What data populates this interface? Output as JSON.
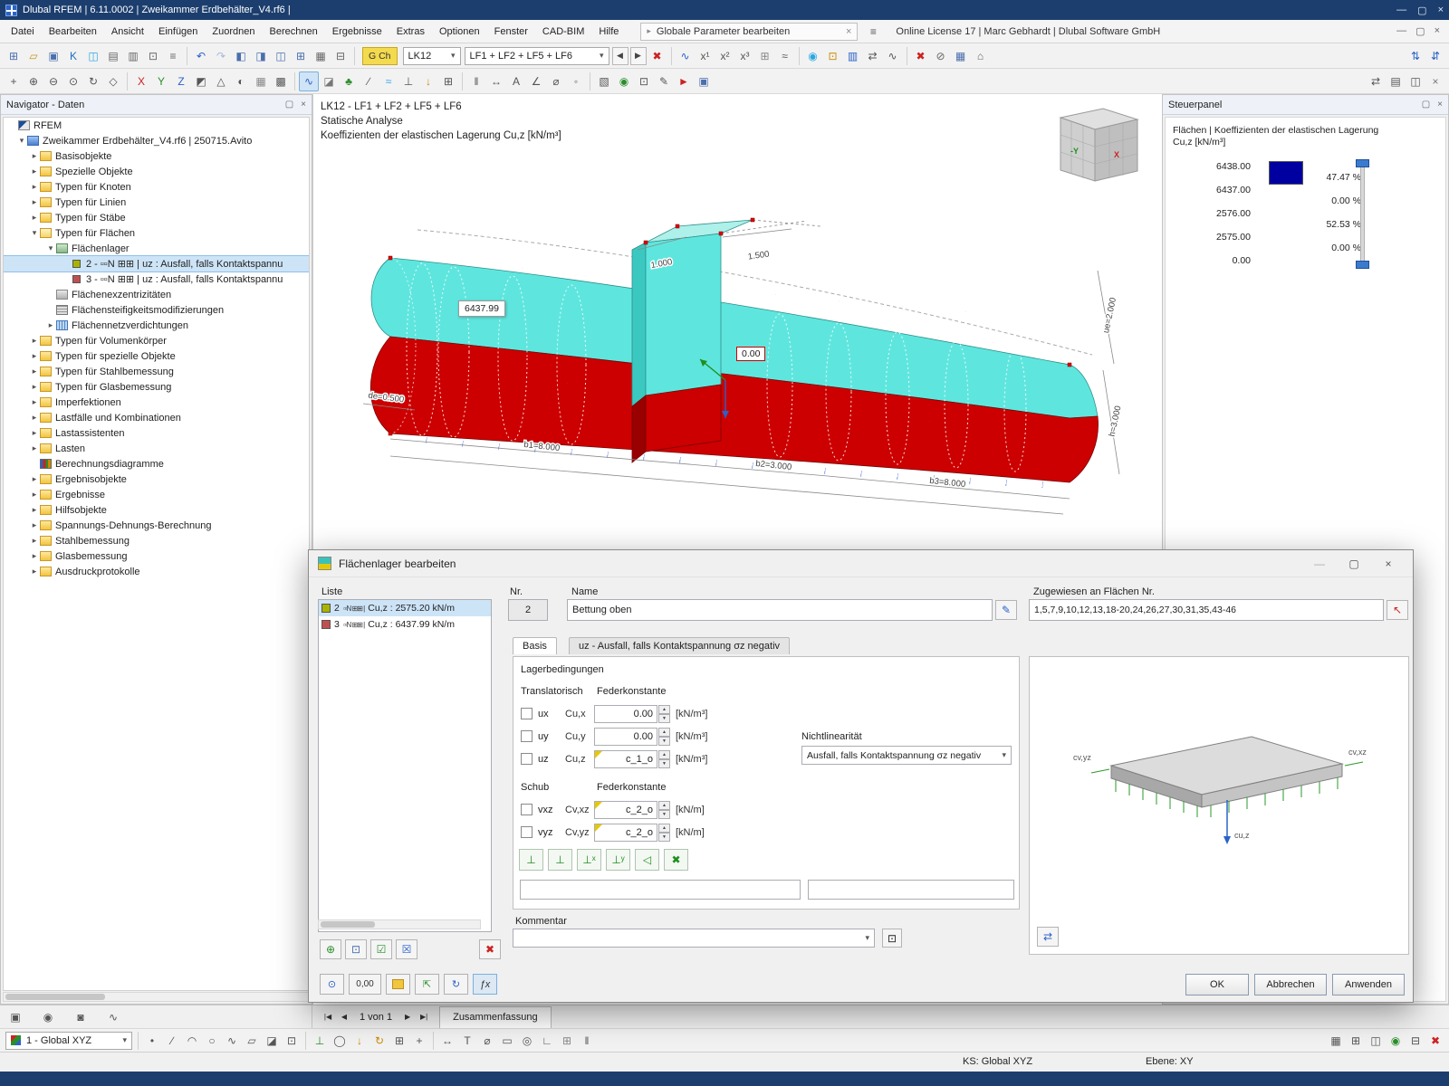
{
  "titlebar": {
    "title": "Dlubal RFEM | 6.11.0002 | Zweikammer Erdbehälter_V4.rf6 |"
  },
  "menubar": {
    "items": [
      "Datei",
      "Bearbeiten",
      "Ansicht",
      "Einfügen",
      "Zuordnen",
      "Berechnen",
      "Ergebnisse",
      "Extras",
      "Optionen",
      "Fenster",
      "CAD-BIM",
      "Hilfe"
    ],
    "search_label": "Globale Parameter bearbeiten",
    "license_text": "Online License 17 | Marc Gebhardt | Dlubal Software GmbH"
  },
  "toolbars": {
    "chip_label": "G Ch",
    "combo_lk": "LK12",
    "combo_lf": "LF1 + LF2 + LF5 + LF6",
    "row1a": [
      {
        "n": "new-model-icon",
        "g": "⊞",
        "c": "#4a6fae"
      },
      {
        "n": "open-model-icon",
        "g": "▱",
        "c": "#c89616"
      },
      {
        "n": "save-icon",
        "g": "▣",
        "c": "#4a6fae"
      },
      {
        "n": "knowledge-base-icon",
        "g": "K",
        "c": "#1a6fc4"
      },
      {
        "n": "teamwork-icon",
        "g": "◫",
        "c": "#29a8e0"
      },
      {
        "n": "print-icon",
        "g": "▤",
        "c": "#666666"
      },
      {
        "n": "printout-report-icon",
        "g": "▥",
        "c": "#666666"
      },
      {
        "n": "copy-icon",
        "g": "⊡",
        "c": "#666666"
      },
      {
        "n": "tables-icon",
        "g": "≡",
        "c": "#666666"
      }
    ],
    "row1b": [
      {
        "n": "undo-icon",
        "g": "↶",
        "c": "#2a62c9"
      },
      {
        "n": "redo-icon",
        "g": "↷",
        "c": "#a8b8d8"
      },
      {
        "n": "window-layout-icon",
        "g": "◧",
        "c": "#4a6fae"
      },
      {
        "n": "split-view-icon",
        "g": "◨",
        "c": "#4a6fae"
      },
      {
        "n": "table-window-icon",
        "g": "◫",
        "c": "#4a6fae"
      },
      {
        "n": "grid-view-icon",
        "g": "⊞",
        "c": "#4a6fae"
      },
      {
        "n": "table-settings-icon",
        "g": "▦",
        "c": "#666666"
      },
      {
        "n": "hide-table-icon",
        "g": "⊟",
        "c": "#666666"
      }
    ],
    "row1c": [
      {
        "n": "result-diagram-icon",
        "g": "∿",
        "c": "#2a62c9"
      },
      {
        "n": "result-values-icon",
        "g": "x¹",
        "c": "#555555"
      },
      {
        "n": "max-values-icon",
        "g": "x²",
        "c": "#555555"
      },
      {
        "n": "min-values-icon",
        "g": "x³",
        "c": "#555555"
      },
      {
        "n": "result-grid-icon",
        "g": "⊞",
        "c": "#888888"
      },
      {
        "n": "smoothing-icon",
        "g": "≈",
        "c": "#555555"
      }
    ],
    "row1d": [
      {
        "n": "render-results-icon",
        "g": "◉",
        "c": "#29a8e0"
      },
      {
        "n": "surface-values-icon",
        "g": "⊡",
        "c": "#cc8800"
      },
      {
        "n": "result-legend-icon",
        "g": "▥",
        "c": "#2a62c9"
      },
      {
        "n": "compare-icon",
        "g": "⇄",
        "c": "#555555"
      },
      {
        "n": "animation-icon",
        "g": "∿",
        "c": "#555555"
      }
    ],
    "row1e": [
      {
        "n": "delete-results-icon",
        "g": "✖",
        "c": "#cc2222"
      },
      {
        "n": "disable-icon",
        "g": "⊘",
        "c": "#666666"
      },
      {
        "n": "table-manager-icon",
        "g": "▦",
        "c": "#4a6fae"
      },
      {
        "n": "default-view-icon",
        "g": "⌂",
        "c": "#666666"
      }
    ],
    "row1f": [
      {
        "n": "sort-ascending-icon",
        "g": "⇅",
        "c": "#2a62c9"
      },
      {
        "n": "sort-descending-icon",
        "g": "⇵",
        "c": "#2a62c9"
      }
    ],
    "row2a": [
      {
        "n": "pan-icon",
        "g": "+",
        "c": "#555555"
      },
      {
        "n": "zoom-in-icon",
        "g": "⊕",
        "c": "#555555"
      },
      {
        "n": "zoom-out-icon",
        "g": "⊖",
        "c": "#555555"
      },
      {
        "n": "zoom-window-icon",
        "g": "⊙",
        "c": "#555555"
      },
      {
        "n": "rotate-view-icon",
        "g": "↻",
        "c": "#555555"
      },
      {
        "n": "isometric-view-icon",
        "g": "◇",
        "c": "#555555"
      }
    ],
    "row2b": [
      {
        "n": "view-x-icon",
        "g": "X",
        "c": "#cc2222"
      },
      {
        "n": "view-y-icon",
        "g": "Y",
        "c": "#2a8f2a"
      },
      {
        "n": "view-z-icon",
        "g": "Z",
        "c": "#2a62c9"
      },
      {
        "n": "corner-view-icon",
        "g": "◩",
        "c": "#555555"
      },
      {
        "n": "perspective-icon",
        "g": "△",
        "c": "#555555"
      },
      {
        "n": "shading-icon",
        "g": "◐",
        "c": "#555555"
      },
      {
        "n": "wireframe-icon",
        "g": "▦",
        "c": "#888888"
      },
      {
        "n": "solid-view-icon",
        "g": "▩",
        "c": "#555555"
      }
    ],
    "row2c": [
      {
        "n": "results-display-icon",
        "g": "∿",
        "c": "#2a62c9",
        "cls": "hl"
      },
      {
        "n": "model-cube-icon",
        "g": "◪",
        "c": "#777777"
      },
      {
        "n": "vegetation-icon",
        "g": "♣",
        "c": "#2a8f2a"
      },
      {
        "n": "section-line-icon",
        "g": "∕",
        "c": "#555555"
      },
      {
        "n": "water-icon",
        "g": "≈",
        "c": "#29a8e0"
      },
      {
        "n": "support-display-icon",
        "g": "⊥",
        "c": "#555555"
      },
      {
        "n": "load-display-icon",
        "g": "↓",
        "c": "#cc8800"
      },
      {
        "n": "mesh-display-icon",
        "g": "⊞",
        "c": "#555555"
      }
    ],
    "row2d": [
      {
        "n": "guidelines-icon",
        "g": "‖",
        "c": "#555555"
      },
      {
        "n": "dimension-icon",
        "g": "↔",
        "c": "#555555"
      },
      {
        "n": "annotation-icon",
        "g": "A",
        "c": "#555555"
      },
      {
        "n": "angle-icon",
        "g": "∠",
        "c": "#555555"
      },
      {
        "n": "diameter-icon",
        "g": "⌀",
        "c": "#555555"
      },
      {
        "n": "snap-icon",
        "g": "◦",
        "c": "#555555"
      }
    ],
    "row2e": [
      {
        "n": "background-icon",
        "g": "▧",
        "c": "#555555"
      },
      {
        "n": "visibility-icon",
        "g": "◉",
        "c": "#2a8f2a"
      },
      {
        "n": "clipping-icon",
        "g": "⊡",
        "c": "#555555"
      },
      {
        "n": "edit-view-icon",
        "g": "✎",
        "c": "#555555"
      },
      {
        "n": "marker-icon",
        "g": "►",
        "c": "#cc2222"
      },
      {
        "n": "panel-toggle-icon",
        "g": "▣",
        "c": "#4a6fae"
      }
    ],
    "row2f": [
      {
        "n": "swap-icon",
        "g": "⇄",
        "c": "#555555"
      },
      {
        "n": "list-icon",
        "g": "▤",
        "c": "#555555"
      },
      {
        "n": "windows-icon",
        "g": "◫",
        "c": "#555555"
      },
      {
        "n": "close-view-icon",
        "g": "×",
        "c": "#777777"
      }
    ]
  },
  "navigator": {
    "title": "Navigator - Daten",
    "items": [
      {
        "label": "RFEM",
        "pad": "4px",
        "ic": "ic-flag",
        "ar": "",
        "sel": ""
      },
      {
        "label": "Zweikammer Erdbehälter_V4.rf6 | 250715.Avito",
        "pad": "14px",
        "ic": "ic-proj",
        "ar": "ar-d",
        "sel": ""
      },
      {
        "label": "Basisobjekte",
        "pad": "28px",
        "ic": "ic-folder",
        "ar": "ar-r",
        "sel": ""
      },
      {
        "label": "Spezielle Objekte",
        "pad": "28px",
        "ic": "ic-folder",
        "ar": "ar-r",
        "sel": ""
      },
      {
        "label": "Typen für Knoten",
        "pad": "28px",
        "ic": "ic-folder",
        "ar": "ar-r",
        "sel": ""
      },
      {
        "label": "Typen für Linien",
        "pad": "28px",
        "ic": "ic-folder",
        "ar": "ar-r",
        "sel": ""
      },
      {
        "label": "Typen für Stäbe",
        "pad": "28px",
        "ic": "ic-folder",
        "ar": "ar-r",
        "sel": ""
      },
      {
        "label": "Typen für Flächen",
        "pad": "28px",
        "ic": "ic-folder-o",
        "ar": "ar-d",
        "sel": ""
      },
      {
        "label": "Flächenlager",
        "pad": "46px",
        "ic": "ic-lager",
        "ar": "ar-d",
        "sel": ""
      },
      {
        "label": "2 - ▫▫N ⊞⊞ | uz : Ausfall, falls Kontaktspannu",
        "pad": "62px",
        "ic": "ic-sq ic-sq-g",
        "ar": "",
        "sel": "sel"
      },
      {
        "label": "3 - ▫▫N ⊞⊞ | uz : Ausfall, falls Kontaktspannu",
        "pad": "62px",
        "ic": "ic-sq ic-sq-r",
        "ar": "",
        "sel": ""
      },
      {
        "label": "Flächenexzentrizitäten",
        "pad": "46px",
        "ic": "ic-exz",
        "ar": "",
        "sel": ""
      },
      {
        "label": "Flächensteifigkeitsmodifizierungen",
        "pad": "46px",
        "ic": "ic-stiff",
        "ar": "",
        "sel": ""
      },
      {
        "label": "Flächennetzverdichtungen",
        "pad": "46px",
        "ic": "ic-mesh",
        "ar": "ar-r",
        "sel": ""
      },
      {
        "label": "Typen für Volumenkörper",
        "pad": "28px",
        "ic": "ic-folder",
        "ar": "ar-r",
        "sel": ""
      },
      {
        "label": "Typen für spezielle Objekte",
        "pad": "28px",
        "ic": "ic-folder",
        "ar": "ar-r",
        "sel": ""
      },
      {
        "label": "Typen für Stahlbemessung",
        "pad": "28px",
        "ic": "ic-folder",
        "ar": "ar-r",
        "sel": ""
      },
      {
        "label": "Typen für Glasbemessung",
        "pad": "28px",
        "ic": "ic-folder",
        "ar": "ar-r",
        "sel": ""
      },
      {
        "label": "Imperfektionen",
        "pad": "28px",
        "ic": "ic-folder",
        "ar": "ar-r",
        "sel": ""
      },
      {
        "label": "Lastfälle und Kombinationen",
        "pad": "28px",
        "ic": "ic-folder",
        "ar": "ar-r",
        "sel": ""
      },
      {
        "label": "Lastassistenten",
        "pad": "28px",
        "ic": "ic-folder",
        "ar": "ar-r",
        "sel": ""
      },
      {
        "label": "Lasten",
        "pad": "28px",
        "ic": "ic-folder",
        "ar": "ar-r",
        "sel": ""
      },
      {
        "label": "Berechnungsdiagramme",
        "pad": "28px",
        "ic": "ic-chart",
        "ar": "",
        "sel": ""
      },
      {
        "label": "Ergebnisobjekte",
        "pad": "28px",
        "ic": "ic-folder",
        "ar": "ar-r",
        "sel": ""
      },
      {
        "label": "Ergebnisse",
        "pad": "28px",
        "ic": "ic-folder",
        "ar": "ar-r",
        "sel": ""
      },
      {
        "label": "Hilfsobjekte",
        "pad": "28px",
        "ic": "ic-folder",
        "ar": "ar-r",
        "sel": ""
      },
      {
        "label": "Spannungs-Dehnungs-Berechnung",
        "pad": "28px",
        "ic": "ic-folder",
        "ar": "ar-r",
        "sel": ""
      },
      {
        "label": "Stahlbemessung",
        "pad": "28px",
        "ic": "ic-folder",
        "ar": "ar-r",
        "sel": ""
      },
      {
        "label": "Glasbemessung",
        "pad": "28px",
        "ic": "ic-folder",
        "ar": "ar-r",
        "sel": ""
      },
      {
        "label": "Ausdruckprotokolle",
        "pad": "28px",
        "ic": "ic-folder",
        "ar": "ar-r",
        "sel": ""
      }
    ]
  },
  "viewport": {
    "header1": "LK12 - LF1 + LF2 + LF5 + LF6",
    "header2": "Statische Analyse",
    "header3": "Koeffizienten der elastischen Lagerung Cu,z [kN/m³]",
    "tooltip_value": "6437.99",
    "node_value": "0.00",
    "dim_de": "de=0.500",
    "dim_b1": "b1=8.000",
    "dim_b2": "b2=3.000",
    "dim_b3": "b3=8.000",
    "dim_t1": "1.000",
    "dim_t2": "1.500",
    "dim_ue": "ue=2.000",
    "dim_h": "h=3.000",
    "axis_x": "x",
    "cube_y": "-Y",
    "cube_x": "X",
    "surface_top_color": "#5ee6de",
    "surface_bottom_color": "#cc0000"
  },
  "steuerpanel": {
    "title": "Steuerpanel",
    "subtitle1": "Flächen | Koeffizienten der elastischen Lagerung",
    "subtitle2": "Cu,z [kN/m³]",
    "values": [
      "6438.00",
      "6437.00",
      "2576.00",
      "2575.00",
      "0.00"
    ],
    "legend": [
      {
        "style": "background:#c00000",
        "pct": "47.47 %"
      },
      {
        "style": "background:#e8dc00",
        "pct": "0.00 %"
      },
      {
        "style": "background:#00e0e0",
        "pct": "52.53 %"
      },
      {
        "style": "background:#0000a0",
        "pct": "0.00 %"
      }
    ]
  },
  "dialog": {
    "title": "Flächenlager bearbeiten",
    "liste_label": "Liste",
    "list": [
      {
        "num": "2",
        "glyphs": "▫▫N ⊞⊞ |",
        "label": "Cu,z : 2575.20 kN/m",
        "color": "#aab400",
        "sel": "sel"
      },
      {
        "num": "3",
        "glyphs": "▫▫N ⊞⊞ |",
        "label": "Cu,z : 6437.99 kN/m",
        "color": "#c05050",
        "sel": ""
      }
    ],
    "nr_label": "Nr.",
    "nr_value": "2",
    "name_label": "Name",
    "name_value": "Bettung oben",
    "assigned_label": "Zugewiesen an Flächen Nr.",
    "assigned_value": "1,5,7,9,10,12,13,18-20,24,26,27,30,31,35,43-46",
    "tab1": "Basis",
    "tab2": "uz - Ausfall, falls Kontaktspannung σz negativ",
    "group_title": "Lagerbedingungen",
    "col_trans": "Translatorisch",
    "col_feder": "Federkonstante",
    "col_schub": "Schub",
    "col_feder2": "Federkonstante",
    "nl_label": "Nichtlinearität",
    "nl_value": "Ausfall, falls Kontaktspannung σz negativ",
    "rows_trans": [
      {
        "chk": "ux",
        "c": "Cu,x",
        "val": "0.00",
        "unit": "[kN/m³]",
        "fc": ""
      },
      {
        "chk": "uy",
        "c": "Cu,y",
        "val": "0.00",
        "unit": "[kN/m³]",
        "fc": ""
      },
      {
        "chk": "uz",
        "c": "Cu,z",
        "val": "c_1_o",
        "unit": "[kN/m³]",
        "fc": "fcorner"
      }
    ],
    "rows_schub": [
      {
        "chk": "vxz",
        "c": "Cv,xz",
        "val": "c_2_o",
        "unit": "[kN/m]",
        "fc": "fcorner"
      },
      {
        "chk": "vyz",
        "c": "Cv,yz",
        "val": "c_2_o",
        "unit": "[kN/m]",
        "fc": "fcorner"
      }
    ],
    "support_icons": [
      {
        "n": "support-fixed-icon",
        "g": "⊥"
      },
      {
        "n": "support-spring-icon",
        "g": "⊥"
      },
      {
        "n": "support-x-icon",
        "g": "⊥ˣ"
      },
      {
        "n": "support-y-icon",
        "g": "⊥ʸ"
      },
      {
        "n": "support-slide-icon",
        "g": "◁"
      },
      {
        "n": "support-free-icon",
        "g": "✖"
      }
    ],
    "kommentar_label": "Kommentar",
    "preview_labels": {
      "cuz": "cu,z",
      "cvxz": "cv,xz",
      "cvyz": "cv,yz"
    },
    "footer_value": "0,00",
    "ok": "OK",
    "cancel": "Abbrechen",
    "apply": "Anwenden"
  },
  "bottom": {
    "pager_first": "|◀",
    "pager_prev": "◀",
    "pager_label": "1 von 1",
    "pager_next": "▶",
    "pager_last": "▶|",
    "tab_label": "Zusammenfassung",
    "cs_combo": "1 - Global XYZ",
    "ks_label": "KS: Global XYZ",
    "ebene_label": "Ebene: XY",
    "nav_icons": [
      {
        "n": "display-tab-icon",
        "g": "▣",
        "c": "#555555"
      },
      {
        "n": "views-tab-icon",
        "g": "◉",
        "c": "#555555"
      },
      {
        "n": "camera-tab-icon",
        "g": "◙",
        "c": "#555555"
      },
      {
        "n": "motion-tab-icon",
        "g": "∿",
        "c": "#555555"
      }
    ],
    "rowB1": [
      {
        "n": "node-tool-icon",
        "g": "•",
        "c": "#555555"
      },
      {
        "n": "line-tool-icon",
        "g": "∕",
        "c": "#555555"
      },
      {
        "n": "arc-tool-icon",
        "g": "◠",
        "c": "#555555"
      },
      {
        "n": "circle-tool-icon",
        "g": "○",
        "c": "#555555"
      },
      {
        "n": "spline-tool-icon",
        "g": "∿",
        "c": "#555555"
      },
      {
        "n": "surface-tool-icon",
        "g": "▱",
        "c": "#555555"
      },
      {
        "n": "solid-tool-icon",
        "g": "◪",
        "c": "#555555"
      },
      {
        "n": "opening-tool-icon",
        "g": "⊡",
        "c": "#555555"
      }
    ],
    "rowB2": [
      {
        "n": "support-tool-icon",
        "g": "⊥",
        "c": "#2a8f2a"
      },
      {
        "n": "hinge-tool-icon",
        "g": "◯",
        "c": "#555555"
      },
      {
        "n": "load-tool-icon",
        "g": "↓",
        "c": "#cc8800"
      },
      {
        "n": "moment-tool-icon",
        "g": "↻",
        "c": "#cc8800"
      },
      {
        "n": "mesh-tool-icon",
        "g": "⊞",
        "c": "#555555"
      },
      {
        "n": "cs-tool-icon",
        "g": "+",
        "c": "#555555"
      }
    ],
    "rowB3": [
      {
        "n": "dimension-tool-icon",
        "g": "↔",
        "c": "#555555"
      },
      {
        "n": "text-tool-icon",
        "g": "T",
        "c": "#555555"
      },
      {
        "n": "section-tool-icon",
        "g": "⌀",
        "c": "#555555"
      },
      {
        "n": "rectangle-tool-icon",
        "g": "▭",
        "c": "#555555"
      },
      {
        "n": "object-snap-icon",
        "g": "◎",
        "c": "#555555"
      },
      {
        "n": "ortho-icon",
        "g": "∟",
        "c": "#555555"
      },
      {
        "n": "snap-grid-icon",
        "g": "⊞",
        "c": "#888888"
      },
      {
        "n": "guide-icon",
        "g": "‖",
        "c": "#555555"
      }
    ],
    "rowB4": [
      {
        "n": "table-toggle-icon",
        "g": "▦",
        "c": "#555555"
      },
      {
        "n": "grid-toggle-icon",
        "g": "⊞",
        "c": "#555555"
      },
      {
        "n": "window-toggle-icon",
        "g": "◫",
        "c": "#555555"
      },
      {
        "n": "eye-icon",
        "g": "◉",
        "c": "#2a8f2a"
      },
      {
        "n": "collapse-icon",
        "g": "⊟",
        "c": "#555555"
      },
      {
        "n": "delete-tool-icon",
        "g": "✖",
        "c": "#cc2222"
      }
    ]
  }
}
